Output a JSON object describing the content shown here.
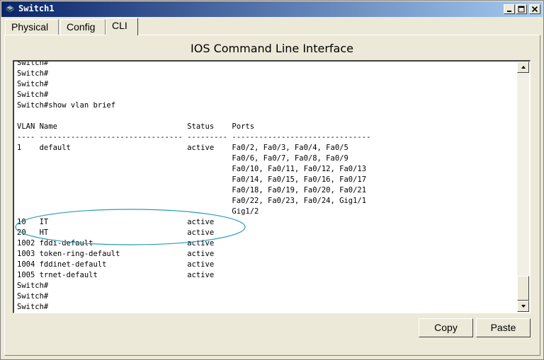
{
  "window": {
    "title": "Switch1",
    "title_icon": "switch-icon",
    "controls": [
      "minimize-icon",
      "maximize-icon",
      "close-icon"
    ]
  },
  "tabs": [
    {
      "label": "Physical",
      "selected": false
    },
    {
      "label": "Config",
      "selected": false
    },
    {
      "label": "CLI",
      "selected": true
    }
  ],
  "cli": {
    "heading": "IOS Command Line Interface",
    "lines": [
      "Switch#",
      "Switch#",
      "Switch#",
      "Switch#",
      "Switch#show vlan brief",
      "",
      "VLAN Name                             Status    Ports",
      "---- -------------------------------- --------- -------------------------------",
      "1    default                          active    Fa0/2, Fa0/3, Fa0/4, Fa0/5",
      "                                                Fa0/6, Fa0/7, Fa0/8, Fa0/9",
      "                                                Fa0/10, Fa0/11, Fa0/12, Fa0/13",
      "                                                Fa0/14, Fa0/15, Fa0/16, Fa0/17",
      "                                                Fa0/18, Fa0/19, Fa0/20, Fa0/21",
      "                                                Fa0/22, Fa0/23, Fa0/24, Gig1/1",
      "                                                Gig1/2",
      "10   IT                               active",
      "20   HT                               active",
      "1002 fddi-default                     active",
      "1003 token-ring-default               active",
      "1004 fddinet-default                  active",
      "1005 trnet-default                    active",
      "Switch#",
      "Switch#",
      "Switch#"
    ],
    "annotation_color": "#2a9bb7"
  },
  "buttons": {
    "copy": "Copy",
    "paste": "Paste"
  }
}
